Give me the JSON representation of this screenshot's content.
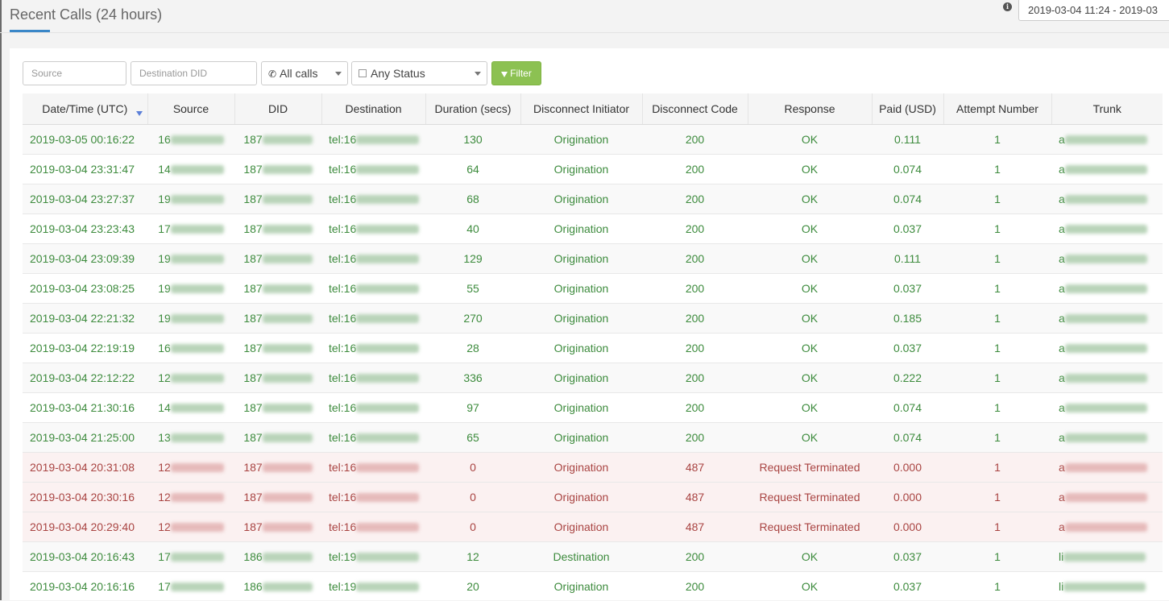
{
  "header": {
    "title": "Recent Calls (24 hours)",
    "date_range": "2019-03-04 11:24 - 2019-03"
  },
  "filters": {
    "source_placeholder": "Source",
    "destination_placeholder": "Destination DID",
    "calls_select": "All calls",
    "status_select": "Any Status",
    "filter_button": "Filter"
  },
  "table": {
    "columns": [
      "Date/Time (UTC)",
      "Source",
      "DID",
      "Destination",
      "Duration (secs)",
      "Disconnect Initiator",
      "Disconnect Code",
      "Response",
      "Paid (USD)",
      "Attempt Number",
      "Trunk"
    ],
    "rows": [
      {
        "datetime": "2019-03-05 00:16:22",
        "source": "16",
        "did": "187",
        "destination": "tel:16",
        "duration": "130",
        "initiator": "Origination",
        "code": "200",
        "response": "OK",
        "paid": "0.111",
        "attempt": "1",
        "trunk": "a",
        "status": "ok"
      },
      {
        "datetime": "2019-03-04 23:31:47",
        "source": "14",
        "did": "187",
        "destination": "tel:16",
        "duration": "64",
        "initiator": "Origination",
        "code": "200",
        "response": "OK",
        "paid": "0.074",
        "attempt": "1",
        "trunk": "a",
        "status": "ok"
      },
      {
        "datetime": "2019-03-04 23:27:37",
        "source": "19",
        "did": "187",
        "destination": "tel:16",
        "duration": "68",
        "initiator": "Origination",
        "code": "200",
        "response": "OK",
        "paid": "0.074",
        "attempt": "1",
        "trunk": "a",
        "status": "ok"
      },
      {
        "datetime": "2019-03-04 23:23:43",
        "source": "17",
        "did": "187",
        "destination": "tel:16",
        "duration": "40",
        "initiator": "Origination",
        "code": "200",
        "response": "OK",
        "paid": "0.037",
        "attempt": "1",
        "trunk": "a",
        "status": "ok"
      },
      {
        "datetime": "2019-03-04 23:09:39",
        "source": "19",
        "did": "187",
        "destination": "tel:16",
        "duration": "129",
        "initiator": "Origination",
        "code": "200",
        "response": "OK",
        "paid": "0.111",
        "attempt": "1",
        "trunk": "a",
        "status": "ok"
      },
      {
        "datetime": "2019-03-04 23:08:25",
        "source": "19",
        "did": "187",
        "destination": "tel:16",
        "duration": "55",
        "initiator": "Origination",
        "code": "200",
        "response": "OK",
        "paid": "0.037",
        "attempt": "1",
        "trunk": "a",
        "status": "ok"
      },
      {
        "datetime": "2019-03-04 22:21:32",
        "source": "19",
        "did": "187",
        "destination": "tel:16",
        "duration": "270",
        "initiator": "Origination",
        "code": "200",
        "response": "OK",
        "paid": "0.185",
        "attempt": "1",
        "trunk": "a",
        "status": "ok"
      },
      {
        "datetime": "2019-03-04 22:19:19",
        "source": "16",
        "did": "187",
        "destination": "tel:16",
        "duration": "28",
        "initiator": "Origination",
        "code": "200",
        "response": "OK",
        "paid": "0.037",
        "attempt": "1",
        "trunk": "a",
        "status": "ok"
      },
      {
        "datetime": "2019-03-04 22:12:22",
        "source": "12",
        "did": "187",
        "destination": "tel:16",
        "duration": "336",
        "initiator": "Origination",
        "code": "200",
        "response": "OK",
        "paid": "0.222",
        "attempt": "1",
        "trunk": "a",
        "status": "ok"
      },
      {
        "datetime": "2019-03-04 21:30:16",
        "source": "14",
        "did": "187",
        "destination": "tel:16",
        "duration": "97",
        "initiator": "Origination",
        "code": "200",
        "response": "OK",
        "paid": "0.074",
        "attempt": "1",
        "trunk": "a",
        "status": "ok"
      },
      {
        "datetime": "2019-03-04 21:25:00",
        "source": "13",
        "did": "187",
        "destination": "tel:16",
        "duration": "65",
        "initiator": "Origination",
        "code": "200",
        "response": "OK",
        "paid": "0.074",
        "attempt": "1",
        "trunk": "a",
        "status": "ok"
      },
      {
        "datetime": "2019-03-04 20:31:08",
        "source": "12",
        "did": "187",
        "destination": "tel:16",
        "duration": "0",
        "initiator": "Origination",
        "code": "487",
        "response": "Request Terminated",
        "paid": "0.000",
        "attempt": "1",
        "trunk": "a",
        "status": "error"
      },
      {
        "datetime": "2019-03-04 20:30:16",
        "source": "12",
        "did": "187",
        "destination": "tel:16",
        "duration": "0",
        "initiator": "Origination",
        "code": "487",
        "response": "Request Terminated",
        "paid": "0.000",
        "attempt": "1",
        "trunk": "a",
        "status": "error"
      },
      {
        "datetime": "2019-03-04 20:29:40",
        "source": "12",
        "did": "187",
        "destination": "tel:16",
        "duration": "0",
        "initiator": "Origination",
        "code": "487",
        "response": "Request Terminated",
        "paid": "0.000",
        "attempt": "1",
        "trunk": "a",
        "status": "error"
      },
      {
        "datetime": "2019-03-04 20:16:43",
        "source": "17",
        "did": "186",
        "destination": "tel:19",
        "duration": "12",
        "initiator": "Destination",
        "code": "200",
        "response": "OK",
        "paid": "0.037",
        "attempt": "1",
        "trunk": "li",
        "status": "ok"
      },
      {
        "datetime": "2019-03-04 20:16:16",
        "source": "17",
        "did": "186",
        "destination": "tel:19",
        "duration": "20",
        "initiator": "Origination",
        "code": "200",
        "response": "OK",
        "paid": "0.037",
        "attempt": "1",
        "trunk": "li",
        "status": "ok"
      }
    ]
  }
}
